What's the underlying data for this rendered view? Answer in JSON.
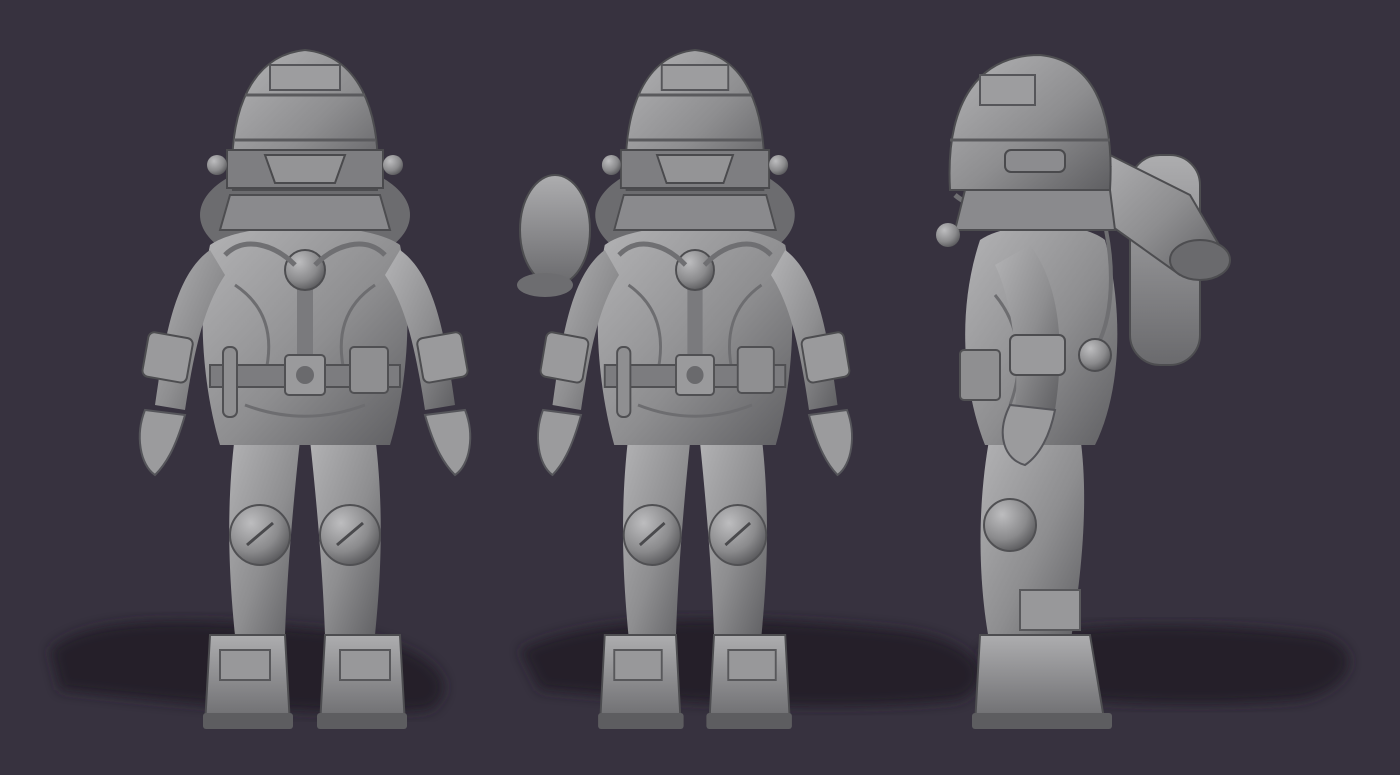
{
  "scene": {
    "background": "#37323f",
    "shadow_color": "#1f1b25",
    "clay_light": "#a9a9ab",
    "clay_mid": "#8a8a8c",
    "clay_dark": "#5e5e61",
    "clay_edge": "#46454a"
  },
  "views": [
    {
      "id": "front"
    },
    {
      "id": "three-quarter"
    },
    {
      "id": "side"
    }
  ]
}
